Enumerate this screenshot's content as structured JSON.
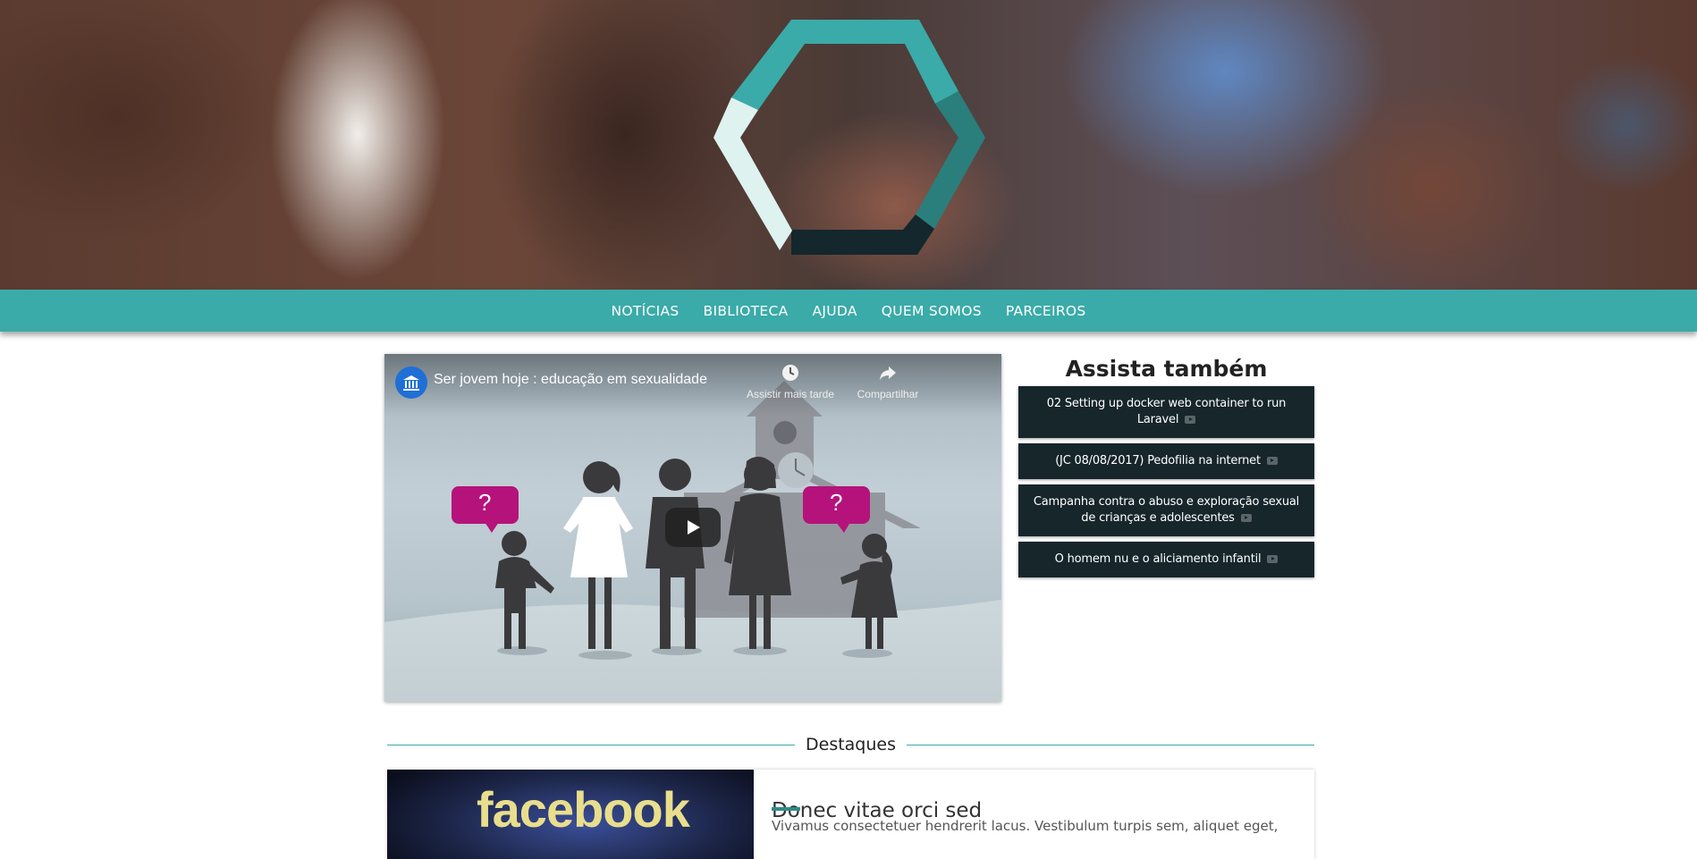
{
  "nav": {
    "items": [
      {
        "label": "NOTÍCIAS"
      },
      {
        "label": "BIBLIOTECA"
      },
      {
        "label": "AJUDA"
      },
      {
        "label": "QUEM SOMOS"
      },
      {
        "label": "PARCEIROS"
      }
    ]
  },
  "video": {
    "title": "Ser jovem hoje : educação em sexualidade",
    "watch_later": "Assistir mais tarde",
    "share": "Compartilhar",
    "bubble_mark": "?"
  },
  "sidebar": {
    "title": "Assista também",
    "videos": [
      {
        "title": "02 Setting up docker web container to run Laravel"
      },
      {
        "title": "(JC 08/08/2017) Pedofilia na internet"
      },
      {
        "title": "Campanha contra o abuso e exploração sexual de crianças e adolescentes"
      },
      {
        "title": "O homem nu e o aliciamento infantil"
      }
    ]
  },
  "highlights": {
    "heading": "Destaques",
    "items": [
      {
        "image_text": "facebook",
        "title": "Donec vitae orci sed",
        "excerpt": "Vivamus consectetuer hendrerit lacus. Vestibulum turpis sem, aliquet eget,"
      }
    ]
  },
  "colors": {
    "nav_bg": "#3aaba8",
    "card_bg": "#16262b",
    "accent_dark": "#2f8c86",
    "bubble": "#b5137b"
  },
  "icons": {
    "logo": "hexagon-logo",
    "watch_later": "clock-icon",
    "share": "share-arrow-icon",
    "play": "play-icon",
    "channel": "unesco-icon"
  }
}
